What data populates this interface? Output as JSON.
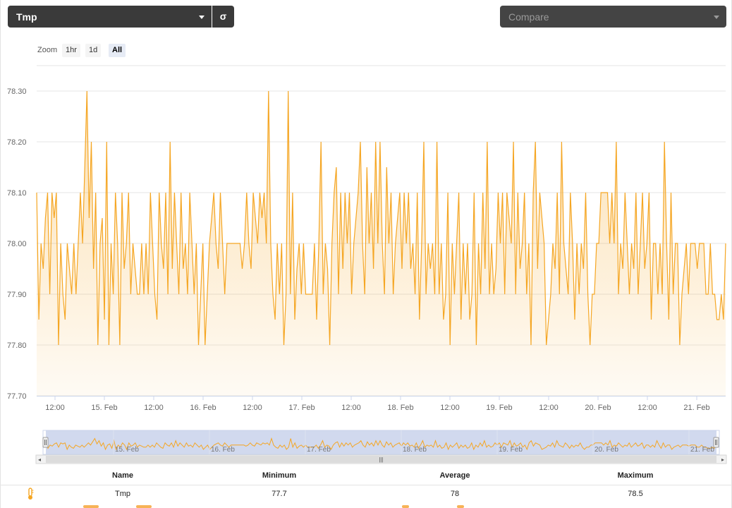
{
  "toolbar": {
    "metric_select": "Tmp",
    "sigma_label": "σ",
    "compare_placeholder": "Compare"
  },
  "zoom": {
    "label": "Zoom",
    "buttons": [
      "1hr",
      "1d",
      "All"
    ],
    "active": "All"
  },
  "colors": {
    "series": "#f5a623",
    "navigator_mask": "#c5d0ea",
    "dark_control": "#3a3a3a"
  },
  "chart_data": {
    "type": "area",
    "title": "",
    "xlabel": "",
    "ylabel": "",
    "ylim": [
      77.7,
      78.35
    ],
    "y_ticks": [
      "77.70",
      "77.80",
      "77.90",
      "78.00",
      "78.10",
      "78.20",
      "78.30"
    ],
    "x_ticks": [
      "12:00",
      "15. Feb",
      "12:00",
      "16. Feb",
      "12:00",
      "17. Feb",
      "12:00",
      "18. Feb",
      "12:00",
      "19. Feb",
      "12:00",
      "20. Feb",
      "12:00",
      "21. Feb"
    ],
    "navigator_ticks": [
      "15. Feb",
      "16. Feb",
      "17. Feb",
      "18. Feb",
      "19. Feb",
      "20. Feb",
      "21. Feb"
    ],
    "grid": true,
    "series": [
      {
        "name": "Tmp",
        "values": [
          78.1,
          77.85,
          78.0,
          77.95,
          78.05,
          78.1,
          77.9,
          78.1,
          78.05,
          78.1,
          77.8,
          78.0,
          77.9,
          77.85,
          78.0,
          77.95,
          77.9,
          78.0,
          77.9,
          78.0,
          78.1,
          78.0,
          78.15,
          78.3,
          78.05,
          78.2,
          77.95,
          78.1,
          77.8,
          78.0,
          78.05,
          77.85,
          78.2,
          77.8,
          78.0,
          77.9,
          78.1,
          78.0,
          77.8,
          78.1,
          77.95,
          78.0,
          78.1,
          77.9,
          78.0,
          77.95,
          77.9,
          77.9,
          78.0,
          77.9,
          78.0,
          77.9,
          78.1,
          78.0,
          77.9,
          77.85,
          78.1,
          78.0,
          77.95,
          78.1,
          77.9,
          78.2,
          77.95,
          78.1,
          78.0,
          77.9,
          78.1,
          77.95,
          78.0,
          77.9,
          78.1,
          78.0,
          77.9,
          78.0,
          77.8,
          77.9,
          78.0,
          77.8,
          77.9,
          78.0,
          78.05,
          78.1,
          78.0,
          77.95,
          78.1,
          78.0,
          77.9,
          78.0,
          78.0,
          78.0,
          78.0,
          78.0,
          78.0,
          78.0,
          77.95,
          78.0,
          78.1,
          78.0,
          77.95,
          78.1,
          78.05,
          78.0,
          78.1,
          78.05,
          78.1,
          78.0,
          78.3,
          78.0,
          77.9,
          77.85,
          78.0,
          77.9,
          78.0,
          77.8,
          77.9,
          78.3,
          77.9,
          78.1,
          77.85,
          77.95,
          78.0,
          77.9,
          78.0,
          77.9,
          77.9,
          77.9,
          77.9,
          78.0,
          77.85,
          78.0,
          78.2,
          77.9,
          78.0,
          77.95,
          77.8,
          78.0,
          78.1,
          78.15,
          77.9,
          78.1,
          77.95,
          78.1,
          78.0,
          78.1,
          77.9,
          78.0,
          78.05,
          78.1,
          78.2,
          78.0,
          77.9,
          78.15,
          78.0,
          78.1,
          77.95,
          78.2,
          78.0,
          78.2,
          78.0,
          77.9,
          78.15,
          78.0,
          78.1,
          77.9,
          78.0,
          78.05,
          78.1,
          77.95,
          78.1,
          78.0,
          78.1,
          77.95,
          78.0,
          77.9,
          78.1,
          77.85,
          78.0,
          78.2,
          77.9,
          78.0,
          77.95,
          78.0,
          77.9,
          78.2,
          77.9,
          78.0,
          77.85,
          77.9,
          78.1,
          77.8,
          78.0,
          77.9,
          78.0,
          78.1,
          77.85,
          78.0,
          77.9,
          78.0,
          77.85,
          77.9,
          78.1,
          77.8,
          78.0,
          77.9,
          78.1,
          77.95,
          78.2,
          77.9,
          78.0,
          77.9,
          77.95,
          78.1,
          78.0,
          78.1,
          77.9,
          78.1,
          78.05,
          78.0,
          78.2,
          77.9,
          78.1,
          77.95,
          78.0,
          78.1,
          77.9,
          78.0,
          77.8,
          78.1,
          78.2,
          77.95,
          78.1,
          78.05,
          78.0,
          77.8,
          77.85,
          77.9,
          78.0,
          77.95,
          78.1,
          77.9,
          78.2,
          78.0,
          77.95,
          77.9,
          78.1,
          78.0,
          77.85,
          78.0,
          77.9,
          78.0,
          77.95,
          78.1,
          77.9,
          77.8,
          77.9,
          77.9,
          78.0,
          78.0,
          78.1,
          78.1,
          78.1,
          78.1,
          78.0,
          78.1,
          78.0,
          78.2,
          77.9,
          78.0,
          77.95,
          78.1,
          78.0,
          77.9,
          78.0,
          77.95,
          78.1,
          77.9,
          78.0,
          78.1,
          77.95,
          78.0,
          78.1,
          77.85,
          78.0,
          78.0,
          77.9,
          78.0,
          77.9,
          78.2,
          78.0,
          77.85,
          78.1,
          77.9,
          78.0,
          78.0,
          77.8,
          77.9,
          77.95,
          78.0,
          77.9,
          78.0,
          78.0,
          78.0,
          77.95,
          78.0,
          78.0,
          78.0,
          77.9,
          77.9,
          78.0,
          77.9,
          77.9,
          77.85,
          77.85,
          77.9,
          77.85,
          78.0
        ]
      }
    ]
  },
  "stats_table": {
    "headers": [
      "Name",
      "Minimum",
      "Average",
      "Maximum"
    ],
    "rows": [
      {
        "icon": "thermometer-icon",
        "name": "Tmp",
        "minimum": "77.7",
        "average": "78",
        "maximum": "78.5"
      }
    ]
  }
}
